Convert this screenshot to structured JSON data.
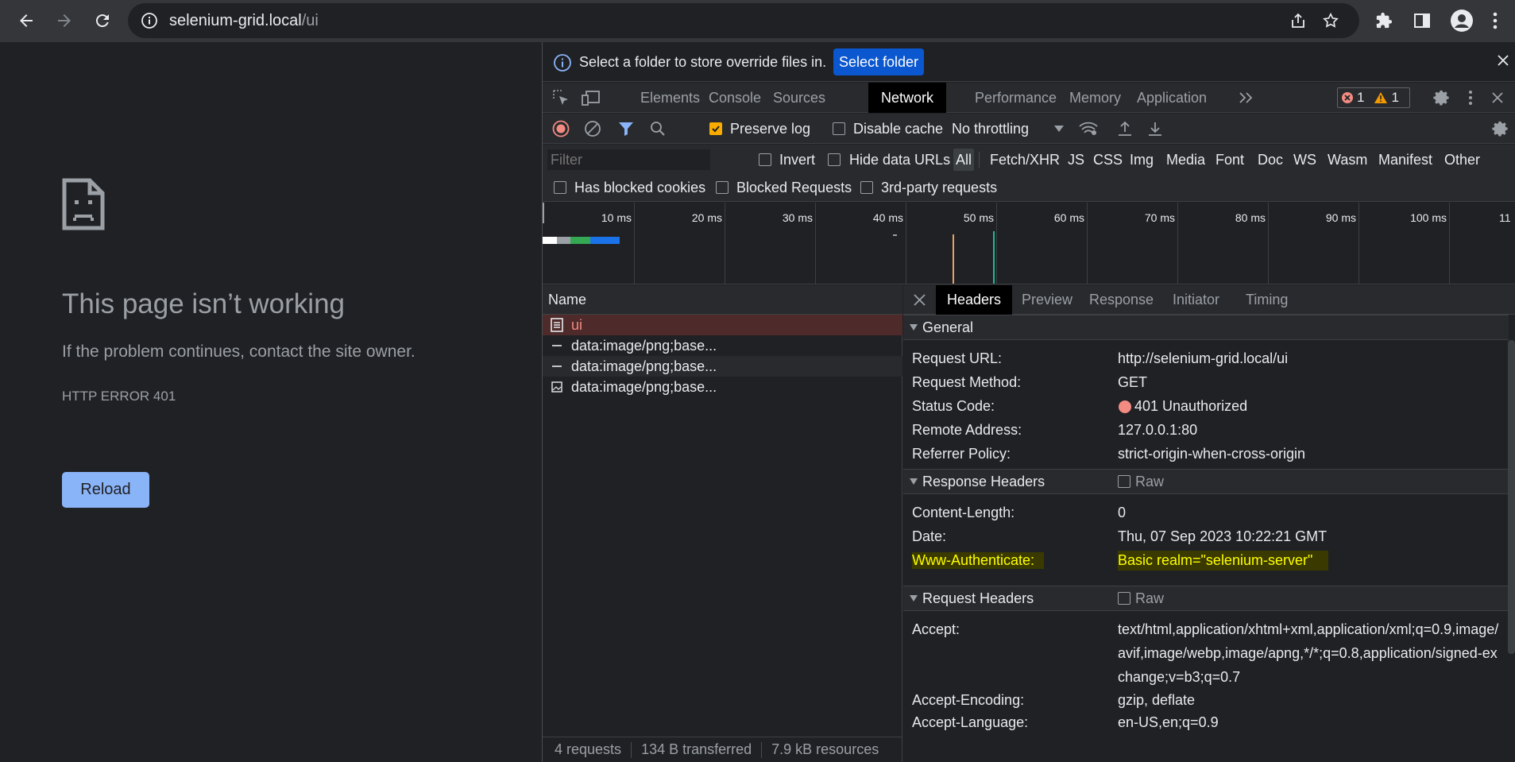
{
  "browser": {
    "url_host": "selenium-grid.local",
    "url_path": "/ui"
  },
  "error_page": {
    "title": "This page isn’t working",
    "message": "If the problem continues, contact the site owner.",
    "code": "HTTP ERROR 401",
    "reload_label": "Reload"
  },
  "devtools": {
    "infobar": {
      "message": "Select a folder to store override files in.",
      "button": "Select folder"
    },
    "tabs": [
      "Elements",
      "Console",
      "Sources",
      "Network",
      "Performance",
      "Memory",
      "Application"
    ],
    "active_tab": "Network",
    "error_count": "1",
    "warning_count": "1",
    "toolbar": {
      "preserve_log": "Preserve log",
      "disable_cache": "Disable cache",
      "throttling": "No throttling"
    },
    "filter": {
      "placeholder": "Filter",
      "invert": "Invert",
      "hide_data_urls": "Hide data URLs",
      "types": [
        "All",
        "Fetch/XHR",
        "JS",
        "CSS",
        "Img",
        "Media",
        "Font",
        "Doc",
        "WS",
        "Wasm",
        "Manifest",
        "Other"
      ],
      "has_blocked_cookies": "Has blocked cookies",
      "blocked_requests": "Blocked Requests",
      "third_party": "3rd-party requests"
    },
    "timeline_ticks": [
      "10 ms",
      "20 ms",
      "30 ms",
      "40 ms",
      "50 ms",
      "60 ms",
      "70 ms",
      "80 ms",
      "90 ms",
      "100 ms",
      "11"
    ],
    "requests": {
      "header": "Name",
      "rows": [
        "ui",
        "data:image/png;base...",
        "data:image/png;base...",
        "data:image/png;base..."
      ],
      "status": {
        "requests": "4 requests",
        "transferred": "134 B transferred",
        "resources": "7.9 kB resources"
      }
    },
    "detail_tabs": [
      "Headers",
      "Preview",
      "Response",
      "Initiator",
      "Timing"
    ],
    "general": {
      "title": "General",
      "request_url_key": "Request URL:",
      "request_url": "http://selenium-grid.local/ui",
      "method_key": "Request Method:",
      "method": "GET",
      "status_key": "Status Code:",
      "status": "401 Unauthorized",
      "remote_key": "Remote Address:",
      "remote": "127.0.0.1:80",
      "referrer_key": "Referrer Policy:",
      "referrer": "strict-origin-when-cross-origin"
    },
    "response_headers": {
      "title": "Response Headers",
      "raw": "Raw",
      "content_length_key": "Content-Length:",
      "content_length": "0",
      "date_key": "Date:",
      "date": "Thu, 07 Sep 2023 10:22:21 GMT",
      "www_auth_key": "Www-Authenticate:",
      "www_auth": "Basic realm=\"selenium-server\""
    },
    "request_headers": {
      "title": "Request Headers",
      "raw": "Raw",
      "accept_key": "Accept:",
      "accept": "text/html,application/xhtml+xml,application/xml;q=0.9,image/avif,image/webp,image/apng,*/*;q=0.8,application/signed-exchange;v=b3;q=0.7",
      "encoding_key": "Accept-Encoding:",
      "encoding": "gzip, deflate",
      "language_key": "Accept-Language:",
      "language": "en-US,en;q=0.9"
    }
  }
}
